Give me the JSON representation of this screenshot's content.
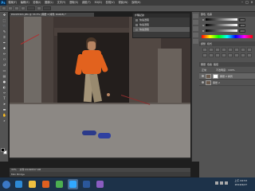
{
  "app": {
    "logo": "Ps"
  },
  "menu": [
    "檔案(F)",
    "編輯(E)",
    "影像(I)",
    "圖層(L)",
    "文字(Y)",
    "選取(S)",
    "濾鏡(T)",
    "3D(D)",
    "檢視(V)",
    "視窗(W)",
    "說明(H)"
  ],
  "window_buttons": [
    "–",
    "□",
    "×"
  ],
  "document": {
    "tab_title": "DSC05321.JPG @ 33.3% (圖層 2 拷貝, RGB/8) *"
  },
  "history": {
    "title": "步驟記錄",
    "items": [
      {
        "label": "快速選取",
        "selected": false
      },
      {
        "label": "快速選取",
        "selected": false
      },
      {
        "label": "快速選取",
        "selected": true
      }
    ]
  },
  "color_panel": {
    "tabs": [
      "顏色",
      "色票"
    ],
    "sliders": [
      {
        "label": "R",
        "value": "200"
      },
      {
        "label": "G",
        "value": "200"
      },
      {
        "label": "B",
        "value": "200"
      }
    ]
  },
  "adjust_panel": {
    "tabs": [
      "調整",
      "樣式"
    ]
  },
  "layers_panel": {
    "tabs": [
      "圖層",
      "色版",
      "路徑"
    ],
    "blend_mode": "正常",
    "opacity_label": "不透明度:",
    "opacity": "100%",
    "layers": [
      {
        "name": "圖層 2 拷貝",
        "selected": true
      },
      {
        "name": "圖層 2",
        "selected": false
      }
    ]
  },
  "status": {
    "zoom": "33%",
    "doc_size": "文件:20.6M/57.0M"
  },
  "bottom_tab": "Mini Bridge",
  "taskbar": {
    "time": "上午 04:53",
    "date": "2014/9/27",
    "apps": [
      {
        "name": "ie",
        "color": "#2d8ad6",
        "active": false
      },
      {
        "name": "folder",
        "color": "#f0c040",
        "active": false
      },
      {
        "name": "media",
        "color": "#e06020",
        "active": false
      },
      {
        "name": "chrome",
        "color": "#4caf50",
        "active": false
      },
      {
        "name": "photoshop",
        "color": "#31a8ff",
        "active": true
      },
      {
        "name": "word",
        "color": "#2b579a",
        "active": false
      },
      {
        "name": "app",
        "color": "#8a5cc0",
        "active": false
      }
    ]
  }
}
